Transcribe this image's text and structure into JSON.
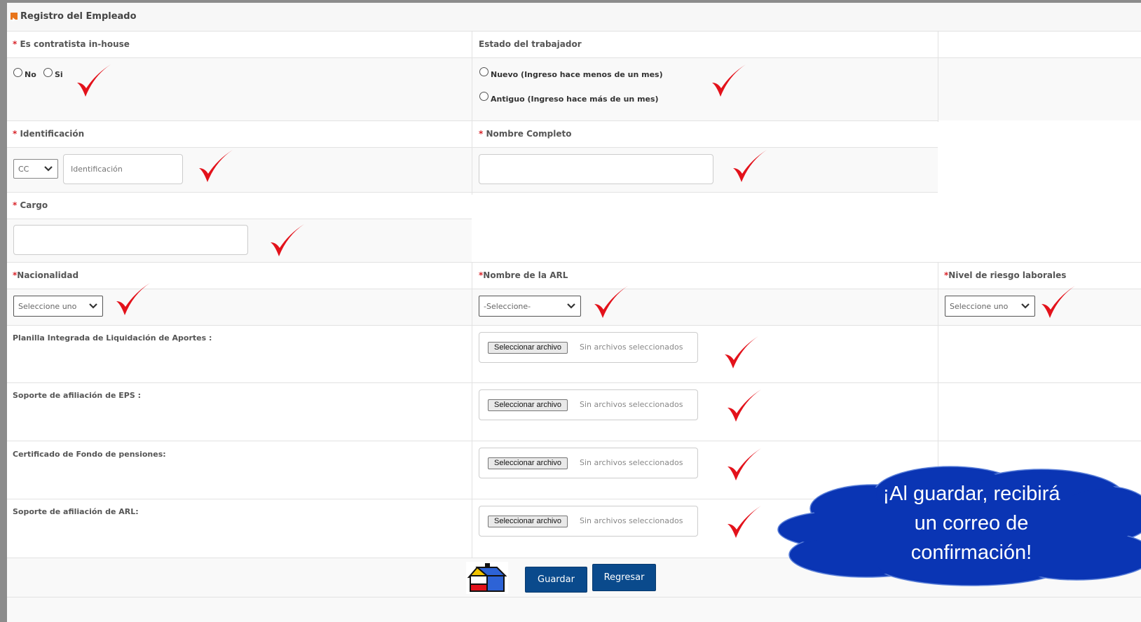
{
  "panel": {
    "title": "Registro del Empleado"
  },
  "fields": {
    "contratista": {
      "required_mark": "*",
      "label": "Es contratista in-house",
      "options": [
        "No",
        "Si"
      ]
    },
    "estado": {
      "label": "Estado del trabajador",
      "options": [
        "Nuevo (Ingreso hace menos de un mes)",
        "Antiguo (Ingreso hace más de un mes)"
      ]
    },
    "identificacion": {
      "required_mark": "*",
      "label": "Identificación",
      "doc_type_value": "CC",
      "placeholder": "Identificación"
    },
    "nombre": {
      "required_mark": "*",
      "label": "Nombre Completo",
      "value": ""
    },
    "cargo": {
      "required_mark": "*",
      "label": "Cargo",
      "value": ""
    },
    "nacionalidad": {
      "required_mark": "*",
      "label": "Nacionalidad",
      "selected": "Seleccione uno"
    },
    "arl": {
      "required_mark": "*",
      "label": "Nombre de la ARL",
      "selected": "-Seleccione-"
    },
    "riesgo": {
      "required_mark": "*",
      "label": "Nivel de riesgo laborales",
      "selected": "Seleccione uno"
    },
    "uploads": [
      {
        "label": "Planilla Integrada de Liquidación de Aportes :",
        "button": "Seleccionar archivo",
        "status": "Sin archivos seleccionados"
      },
      {
        "label": "Soporte de afiliación de EPS :",
        "button": "Seleccionar archivo",
        "status": "Sin archivos seleccionados"
      },
      {
        "label": "Certificado de Fondo de pensiones:",
        "button": "Seleccionar archivo",
        "status": "Sin archivos seleccionados"
      },
      {
        "label": "Soporte de afiliación de ARL:",
        "button": "Seleccionar archivo",
        "status": "Sin archivos seleccionados"
      }
    ]
  },
  "actions": {
    "save": "Guardar",
    "back": "Regresar"
  },
  "callout": {
    "line1": "¡Al guardar, recibirá",
    "line2": "un correo de",
    "line3": "confirmación!"
  },
  "colors": {
    "check": "#e3121b",
    "button": "#0a4a8c",
    "cloud": "#0a35b4",
    "required": "#d9252b"
  },
  "icons": [
    "checkmark-icon",
    "chevron-down-icon",
    "panel-arrow-icon",
    "house-logo-icon"
  ]
}
